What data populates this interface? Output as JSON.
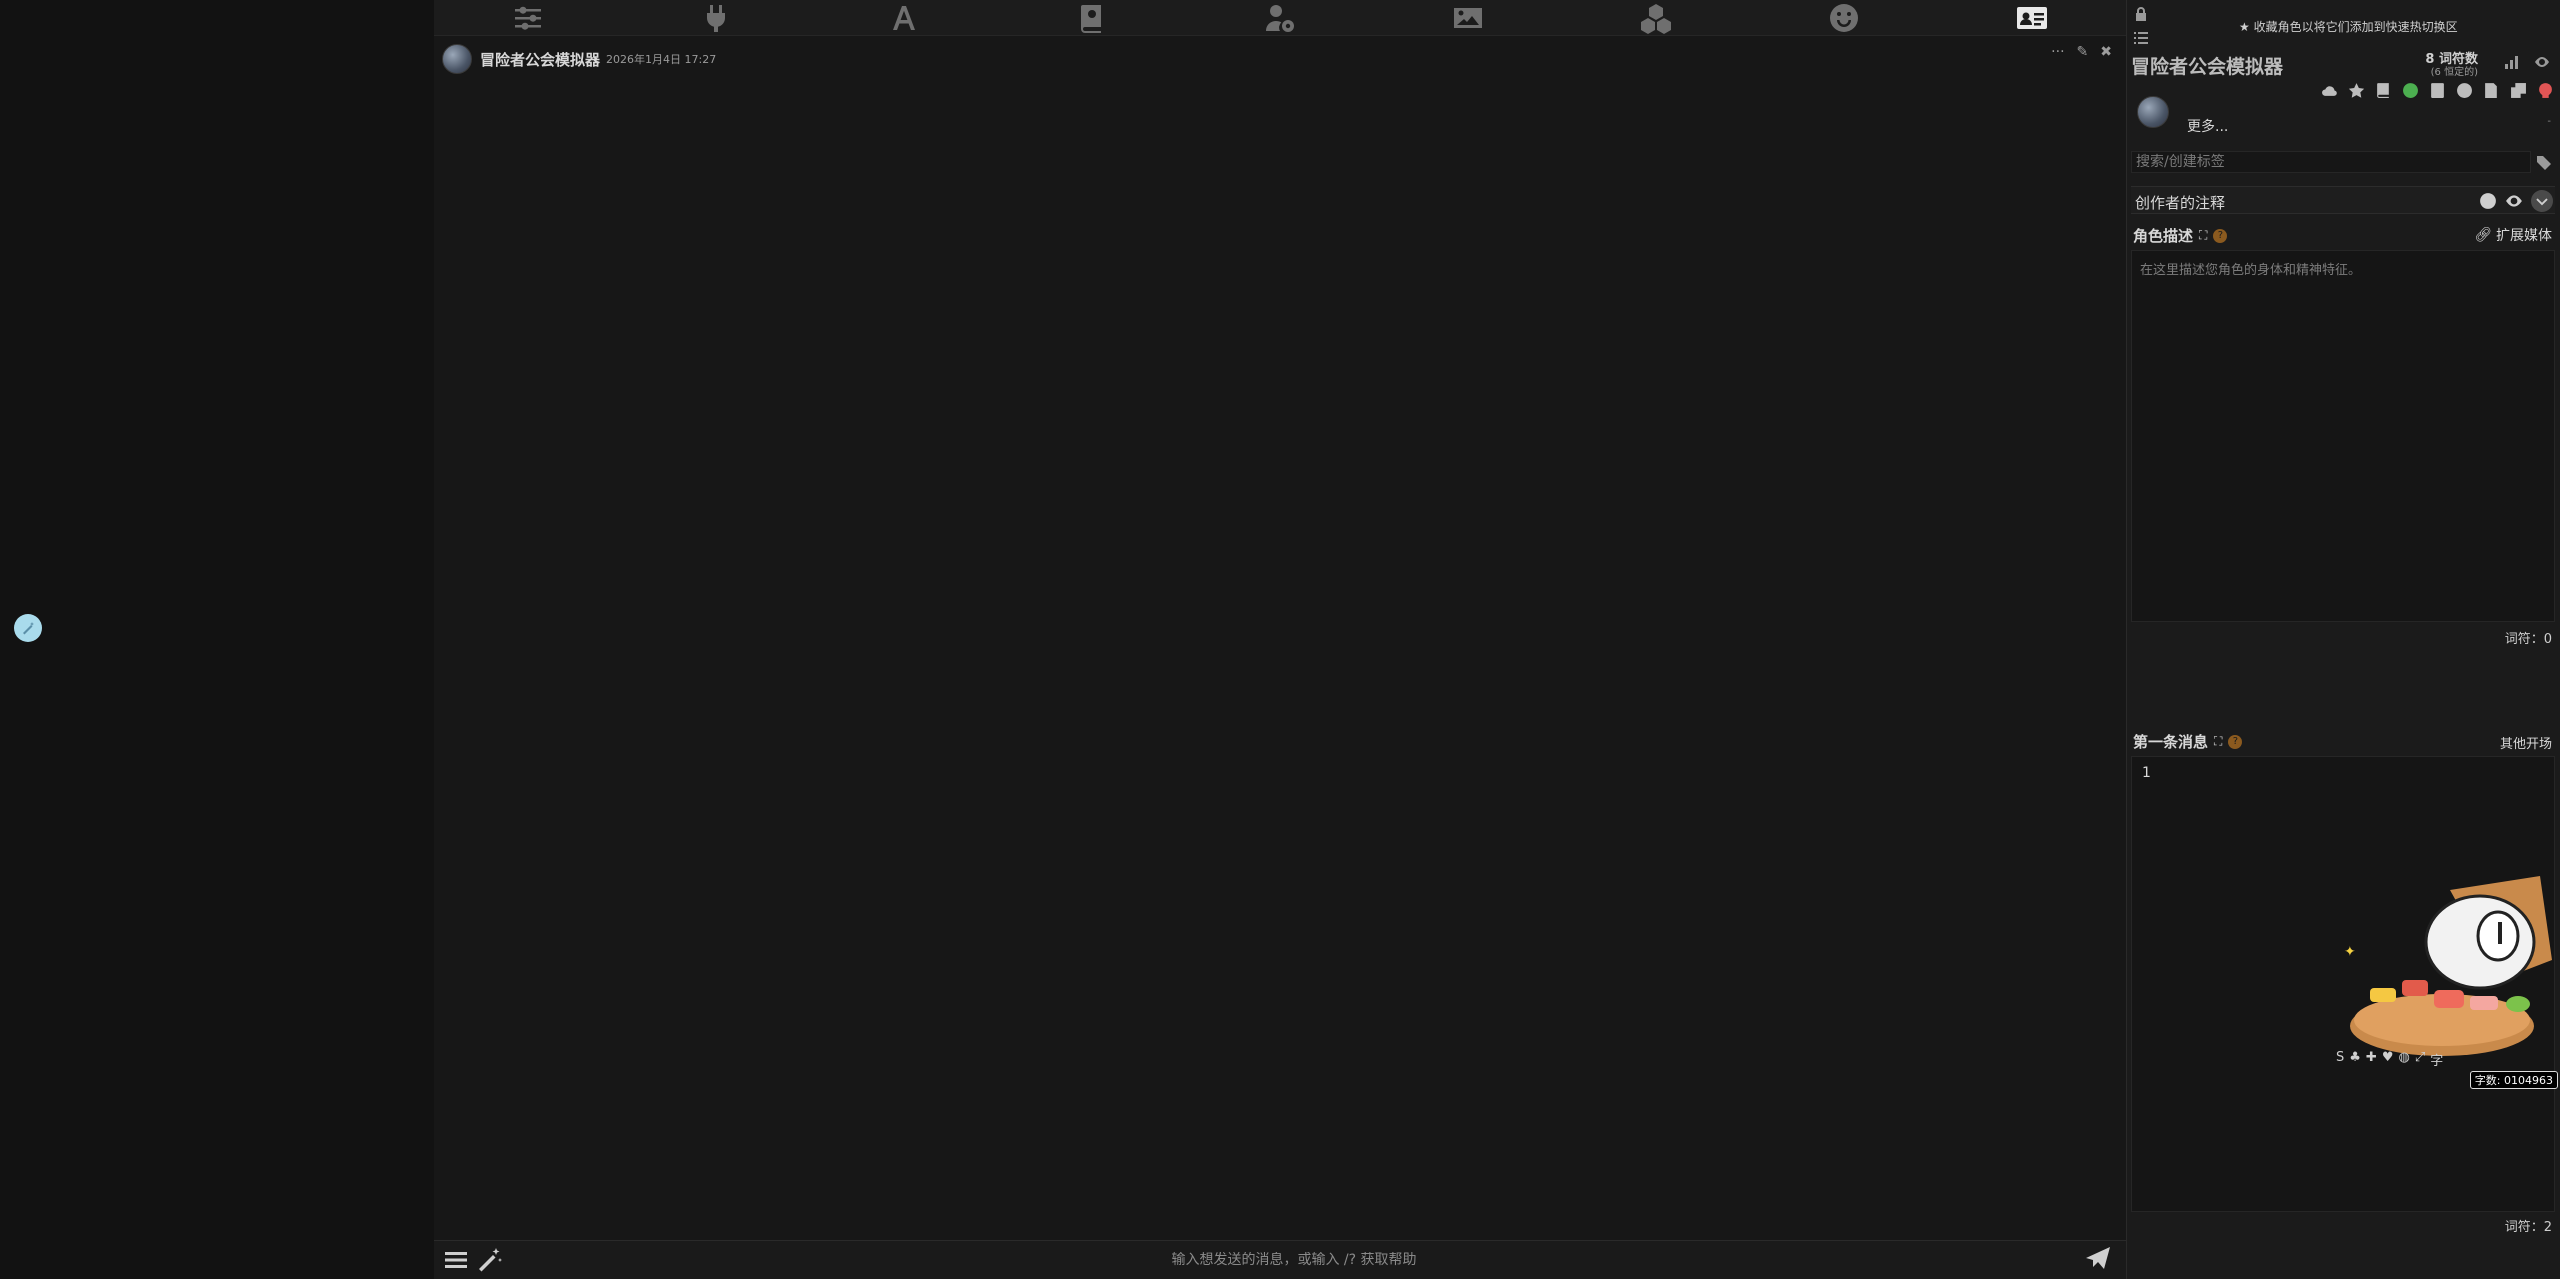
{
  "topbar": {
    "icons": [
      "sliders-icon",
      "plug-icon",
      "font-icon",
      "book-icon",
      "user-gear-icon",
      "image-icon",
      "cubes-icon",
      "smile-icon",
      "id-card-icon"
    ]
  },
  "chat": {
    "message": {
      "name": "冒险者公会模拟器",
      "time": "2026年1月4日 17:27"
    },
    "input_placeholder": "输入想发送的消息，或输入 /? 获取帮助"
  },
  "panel": {
    "fav_hint": "收藏角色以将它们添加到快速热切换区",
    "char_title": "冒险者公会模拟器",
    "token_count": "8 词符数",
    "token_perm": "(6 恒定的)",
    "more_label": "更多...",
    "tag_placeholder": "搜索/创建标签",
    "creator_notes": "创作者的注释",
    "desc_label": "角色描述",
    "expand_media": "扩展媒体",
    "desc_placeholder": "在这里描述您角色的身体和精神特征。",
    "desc_tokens": "词符：0",
    "first_label": "第一条消息",
    "alt_greetings": "其他开场",
    "first_message": "1",
    "first_tokens": "词符：2"
  },
  "mascot": {
    "counter": "字数: 0104963"
  }
}
